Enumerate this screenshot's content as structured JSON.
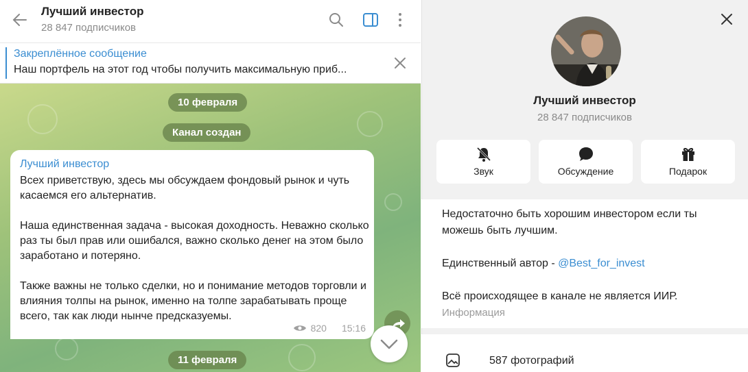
{
  "header": {
    "title": "Лучший инвестор",
    "subtitle": "28 847 подписчиков"
  },
  "pinned": {
    "title": "Закреплённое сообщение",
    "text": "Наш портфель на этот год чтобы получить максимальную приб..."
  },
  "chat": {
    "date1": "10 февраля",
    "service": "Канал создан",
    "message": {
      "author": "Лучший инвестор",
      "text": "Всех приветствую, здесь мы обсуждаем фондовый рынок и чуть касаемся его альтернатив.\n\nНаша единственная задача - высокая доходность. Неважно сколько раз ты был прав или ошибался, важно сколько денег на этом было заработано и потеряно.\n\nТакже важны не только сделки, но и понимание методов торговли и влияния толпы на рынок, именно на толпе зарабатывать проще всего, так как люди нынче предсказуемы.",
      "views": "820",
      "time": "15:16"
    },
    "date2": "11 февраля"
  },
  "profile": {
    "name": "Лучший инвестор",
    "subscribers": "28 847 подписчиков",
    "actions": [
      {
        "label": "Звук",
        "icon": "bell-off-icon"
      },
      {
        "label": "Обсуждение",
        "icon": "chat-bubble-icon"
      },
      {
        "label": "Подарок",
        "icon": "gift-icon"
      }
    ],
    "info": {
      "line1": "Недостаточно быть хорошим инвестором если ты можешь быть лучшим.",
      "author_prefix": "Единственный автор - ",
      "author_link": "@Best_for_invest",
      "line3": "Всё происходящее в канале не является ИИР.",
      "label": "Информация"
    },
    "photos": "587 фотографий"
  },
  "colors": {
    "accent": "#3a8dd1",
    "chat_bg": "#9ec27a",
    "pill": "#68834c"
  }
}
